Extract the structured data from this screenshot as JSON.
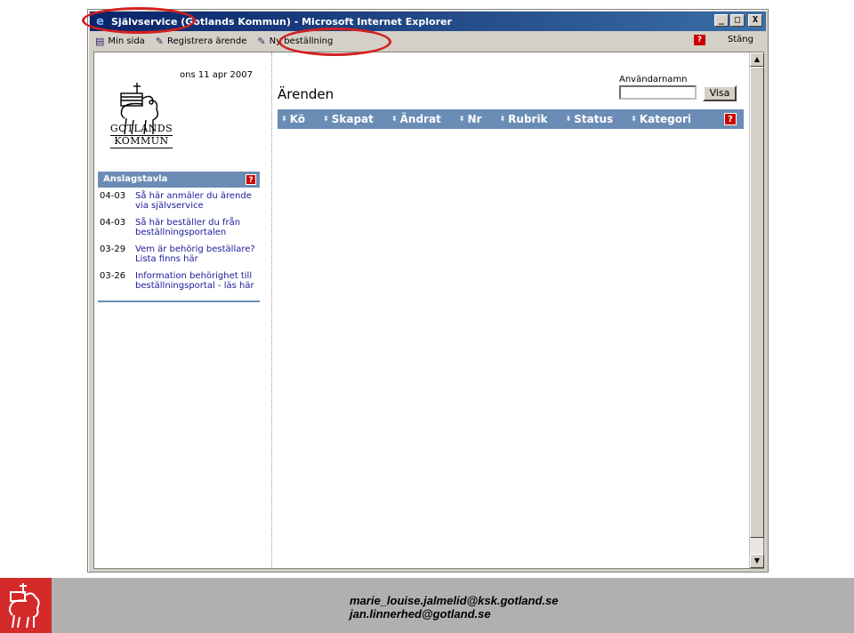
{
  "window": {
    "title": "Självservice (Gotlands Kommun) - Microsoft Internet Explorer",
    "minimize": "_",
    "maximize": "□",
    "close": "X"
  },
  "toolbar": {
    "items": [
      {
        "label": "Min sida",
        "icon": "page-icon"
      },
      {
        "label": "Registrera ärende",
        "icon": "pen-icon"
      },
      {
        "label": "Ny beställning",
        "icon": "pen-icon"
      }
    ],
    "help": "?",
    "close": "Stäng"
  },
  "sidebar": {
    "logo_text_line1": "GOTLANDS",
    "logo_text_line2": "KOMMUN",
    "date": "ons 11 apr 2007",
    "bulletin": {
      "title": "Anslagstavla",
      "help": "?",
      "items": [
        {
          "date": "04-03",
          "text": "Så här anmäler du ärende via självservice"
        },
        {
          "date": "04-03",
          "text": "Så här beställer du från beställningsportalen"
        },
        {
          "date": "03-29",
          "text": "Vem är behörig beställare? Lista finns här"
        },
        {
          "date": "03-26",
          "text": "Information behörighet till beställningsportal - läs här"
        }
      ]
    }
  },
  "main": {
    "heading": "Ärenden",
    "username_label": "Användarnamn",
    "username_value": "",
    "show_button": "Visa",
    "columns": [
      "Kö",
      "Skapat",
      "Ändrat",
      "Nr",
      "Rubrik",
      "Status",
      "Kategori"
    ],
    "help": "?"
  },
  "footer": {
    "email1": "marie_louise.jalmelid@ksk.gotland.se",
    "email2": "jan.linnerhed@gotland.se"
  },
  "colors": {
    "header_blue": "#6b8cb5",
    "annotation_red": "#d22020",
    "titlebar": "#0a246a"
  }
}
